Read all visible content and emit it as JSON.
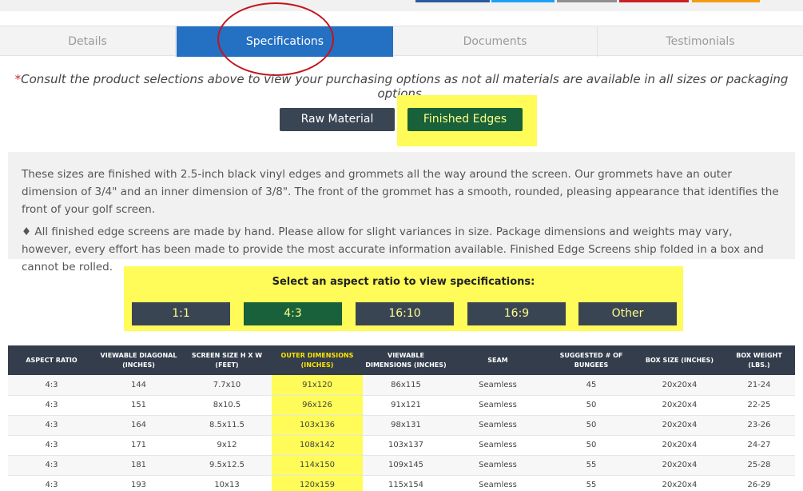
{
  "colors": {
    "tab_active": "#2470c2",
    "dark_button": "#3a4553",
    "active_button": "#18613a",
    "highlight": "#fffb58",
    "annotation_circle": "#c4141c",
    "table_header": "#333d4c"
  },
  "share_bar_colors": [
    "#2b5aa0",
    "#1da1f2",
    "#8f8f8f",
    "#c91f25",
    "#f39c12"
  ],
  "tabs": [
    "Details",
    "Specifications",
    "Documents",
    "Testimonials"
  ],
  "notice": {
    "star": "*",
    "text": "Consult the product selections above to view your purchasing options as not all materials are available in all sizes or packaging options."
  },
  "materials": {
    "raw": "Raw Material",
    "finished": "Finished Edges"
  },
  "description": {
    "p1": "These sizes are finished with 2.5-inch black vinyl edges and grommets all the way around the screen. Our grommets have an outer dimension of 3/4\" and an inner dimension of 3/8\". The front of the grommet has a smooth, rounded, pleasing appearance that identifies the front of your golf screen.",
    "p2": "♦ All finished edge screens are made by hand. Please allow for slight variances in size. Package dimensions and weights may vary, however, every effort has been made to provide the most accurate information available. Finished Edge Screens ship folded in a box and cannot be rolled."
  },
  "aspect": {
    "title": "Select an aspect ratio to view specifications:",
    "options": [
      "1:1",
      "4:3",
      "16:10",
      "16:9",
      "Other"
    ],
    "selected": "4:3"
  },
  "table": {
    "headers": [
      [
        "ASPECT RATIO"
      ],
      [
        "VIEWABLE DIAGONAL",
        "(INCHES)"
      ],
      [
        "SCREEN SIZE H X W",
        "(FEET)"
      ],
      [
        "OUTER DIMENSIONS",
        "(INCHES)"
      ],
      [
        "VIEWABLE",
        "DIMENSIONS (INCHES)"
      ],
      [
        "SEAM"
      ],
      [
        "SUGGESTED # OF",
        "BUNGEES"
      ],
      [
        "BOX SIZE (INCHES)"
      ],
      [
        "BOX WEIGHT (LBS.)"
      ]
    ],
    "rows": [
      [
        "4:3",
        "144",
        "7.7x10",
        "91x120",
        "86x115",
        "Seamless",
        "45",
        "20x20x4",
        "21-24"
      ],
      [
        "4:3",
        "151",
        "8x10.5",
        "96x126",
        "91x121",
        "Seamless",
        "50",
        "20x20x4",
        "22-25"
      ],
      [
        "4:3",
        "164",
        "8.5x11.5",
        "103x136",
        "98x131",
        "Seamless",
        "50",
        "20x20x4",
        "23-26"
      ],
      [
        "4:3",
        "171",
        "9x12",
        "108x142",
        "103x137",
        "Seamless",
        "50",
        "20x20x4",
        "24-27"
      ],
      [
        "4:3",
        "181",
        "9.5x12.5",
        "114x150",
        "109x145",
        "Seamless",
        "55",
        "20x20x4",
        "25-28"
      ],
      [
        "4:3",
        "193",
        "10x13",
        "120x159",
        "115x154",
        "Seamless",
        "55",
        "20x20x4",
        "26-29"
      ]
    ]
  }
}
